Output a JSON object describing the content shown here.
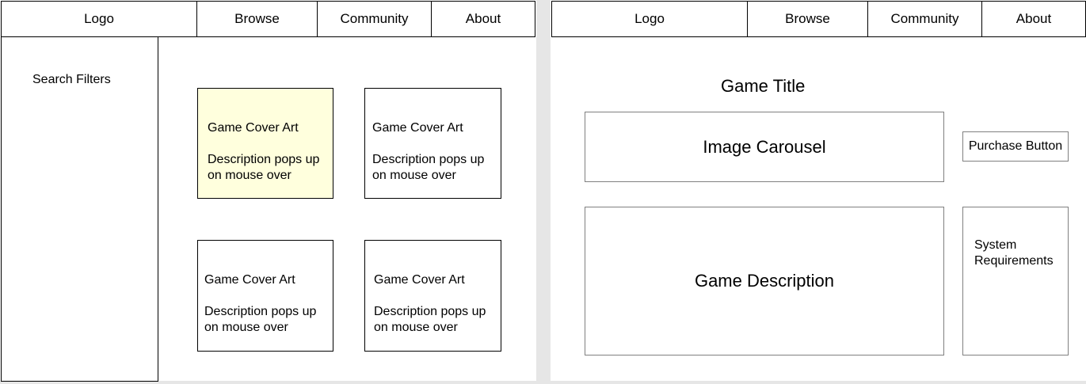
{
  "left_page": {
    "nav": {
      "logo": "Logo",
      "browse": "Browse",
      "community": "Community",
      "about": "About"
    },
    "sidebar": {
      "label": "Search Filters"
    },
    "cards": [
      {
        "title": "Game Cover Art",
        "description": "Description pops up on mouse over",
        "highlight": "#ffffdd"
      },
      {
        "title": "Game Cover Art",
        "description": "Description pops up on mouse over"
      },
      {
        "title": "Game Cover Art",
        "description": "Description pops up on mouse over"
      },
      {
        "title": "Game Cover Art",
        "description": "Description pops up on mouse over"
      }
    ]
  },
  "right_page": {
    "nav": {
      "logo": "Logo",
      "browse": "Browse",
      "community": "Community",
      "about": "About"
    },
    "game_title": "Game Title",
    "image_carousel": "Image Carousel",
    "purchase_button": "Purchase Button",
    "game_description": "Game Description",
    "system_requirements": "System Requirements"
  }
}
